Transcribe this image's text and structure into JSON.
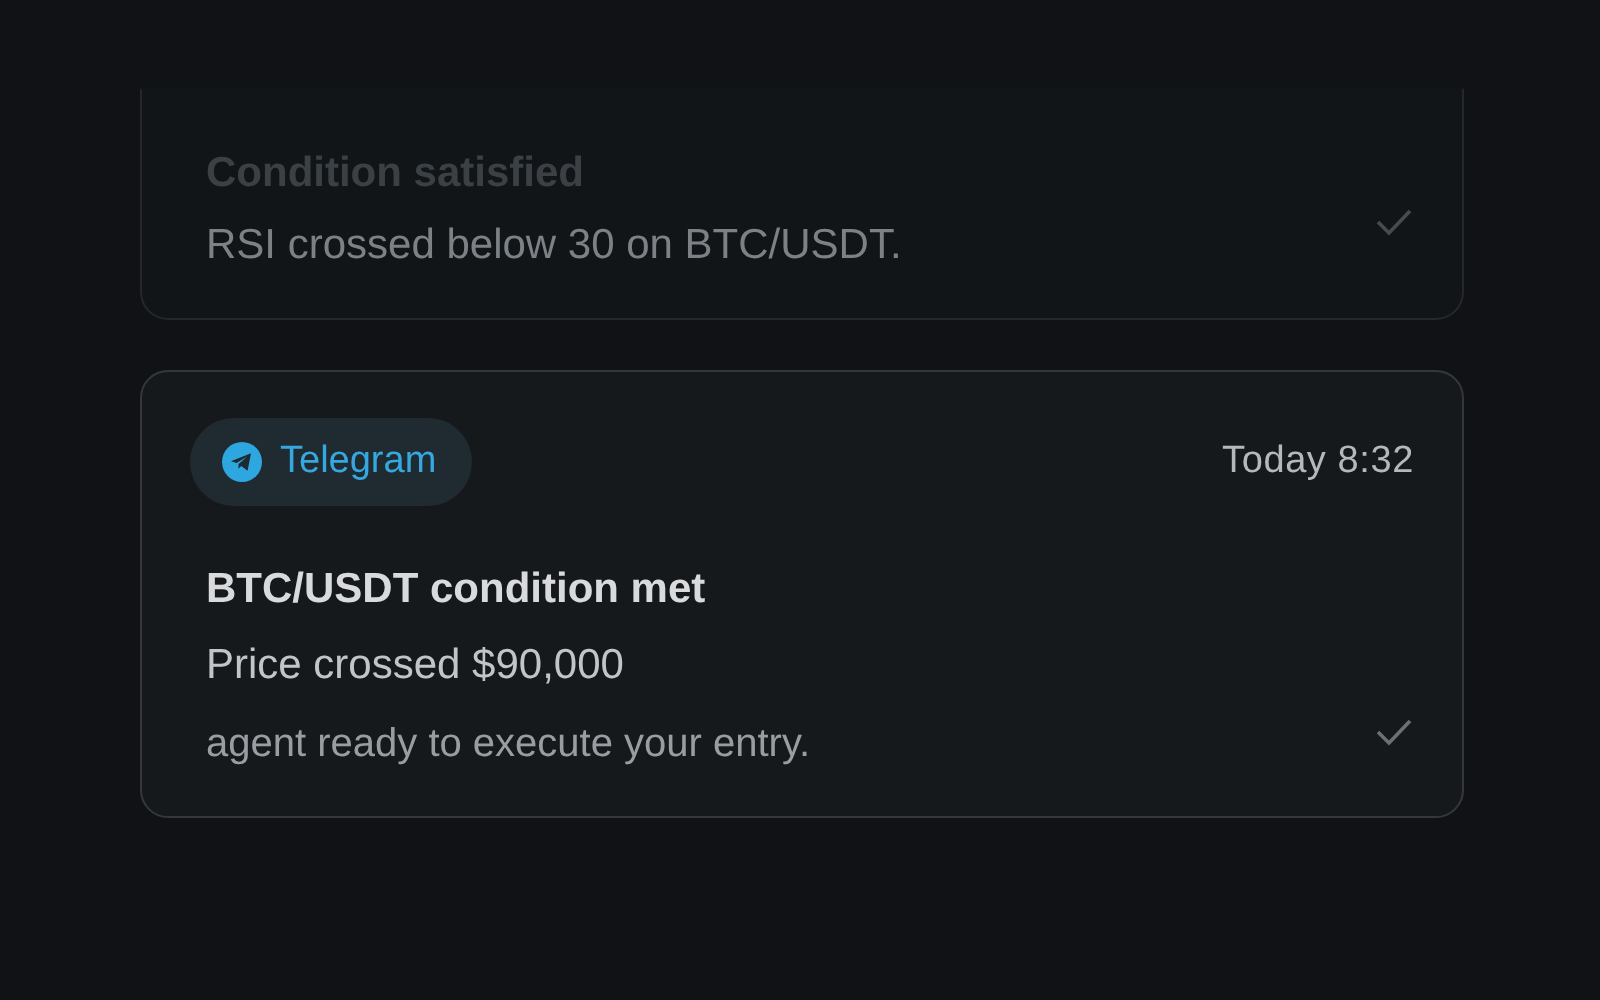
{
  "notifications": [
    {
      "dimmed": true,
      "title": "Condition satisfied",
      "lines": [
        "RSI crossed below 30 on BTC/USDT."
      ],
      "read": true
    },
    {
      "dimmed": false,
      "channel": {
        "kind": "telegram",
        "label": "Telegram"
      },
      "time": "Today 8:32",
      "title": "BTC/USDT condition met",
      "lines": [
        "Price crossed $90,000",
        "agent ready to execute your entry."
      ],
      "read": true
    }
  ]
}
